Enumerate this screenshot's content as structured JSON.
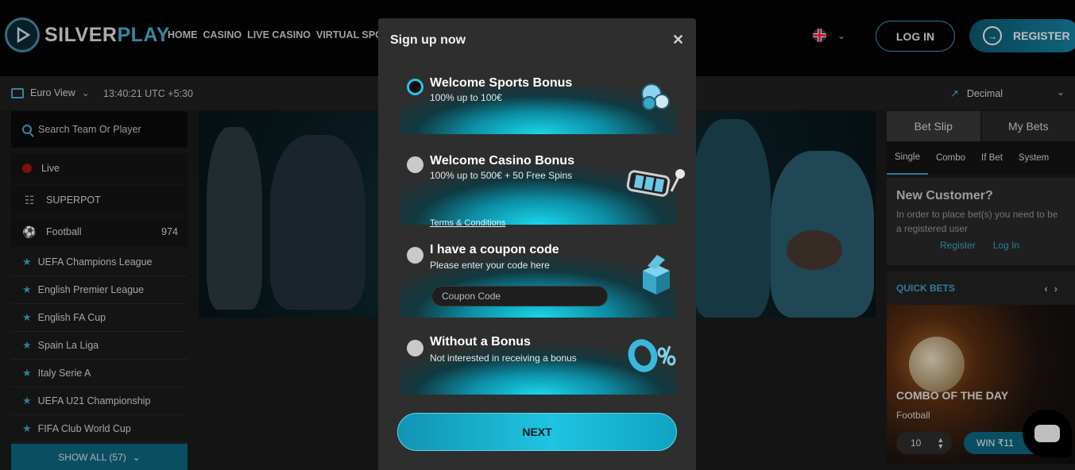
{
  "brand": {
    "name_a": "SILVER",
    "name_b": "PLAY"
  },
  "nav": [
    "HOME",
    "CASINO",
    "LIVE CASINO",
    "VIRTUAL SPORTS"
  ],
  "header": {
    "login": "LOG IN",
    "register": "REGISTER"
  },
  "subbar": {
    "view": "Euro View",
    "time": "13:40:21 UTC +5:30",
    "odds": "Decimal"
  },
  "sidebar": {
    "search_placeholder": "Search Team Or Player",
    "items": [
      {
        "label": "Live"
      },
      {
        "label": "SUPERPOT"
      },
      {
        "label": "Football",
        "count": "974"
      }
    ],
    "leagues": [
      "UEFA Champions League",
      "English Premier League",
      "English FA Cup",
      "Spain La Liga",
      "Italy Serie A",
      "UEFA U21 Championship",
      "FIFA Club World Cup"
    ],
    "show_all": "SHOW ALL (57)"
  },
  "betslip": {
    "tabs": [
      "Bet Slip",
      "My Bets"
    ],
    "subtabs": [
      "Single",
      "Combo",
      "If Bet",
      "System"
    ],
    "new_customer_title": "New Customer?",
    "new_customer_text": "In order to place bet(s) you need to be a registered user",
    "register_link": "Register",
    "login_link": "Log In",
    "quick_bets": "QUICK BETS",
    "combo_title": "COMBO OF THE DAY",
    "combo_sport": "Football",
    "stake": "10",
    "win": "WIN ₹11"
  },
  "modal": {
    "title": "Sign up now",
    "options": [
      {
        "title": "Welcome Sports Bonus",
        "subtitle": "100% up to 100€"
      },
      {
        "title": "Welcome Casino Bonus",
        "subtitle": "100% up to 500€ + 50 Free Spins",
        "link": "Terms & Conditions"
      },
      {
        "title": "I have a coupon code",
        "subtitle": "Please enter your code here",
        "placeholder": "Coupon Code"
      },
      {
        "title": "Without a Bonus",
        "subtitle": "Not interested in receiving a bonus"
      }
    ],
    "next": "NEXT"
  },
  "colors": {
    "accent": "#22c8e6",
    "brand": "#0e6983"
  }
}
